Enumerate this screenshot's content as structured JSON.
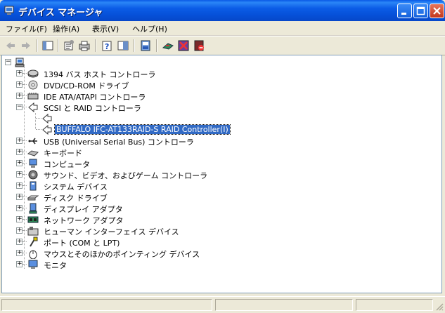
{
  "window": {
    "title": "デバイス マネージャ",
    "icon": "computer-monitor-icon"
  },
  "menu": [
    "ファイル(F)",
    "操作(A)",
    "表示(V)",
    "ヘルプ(H)"
  ],
  "toolbar": {
    "icons": [
      "back-arrow-icon",
      "forward-arrow-icon",
      "show-hide-tree-icon",
      "properties-icon",
      "print-icon",
      "help-icon",
      "view-icon",
      "scan-hardware-icon",
      "update-driver-icon",
      "uninstall-icon",
      "disable-icon"
    ]
  },
  "tree": {
    "root_icon": "computer-icon",
    "items": [
      {
        "label": "1394 バス ホスト コントローラ",
        "icon": "1394-controller-icon",
        "expanded": false
      },
      {
        "label": "DVD/CD-ROM ドライブ",
        "icon": "cdrom-drive-icon",
        "expanded": false
      },
      {
        "label": "IDE ATA/ATAPI コントローラ",
        "icon": "ide-controller-icon",
        "expanded": false
      },
      {
        "label": "SCSI と RAID コントローラ",
        "icon": "scsi-controller-icon",
        "expanded": true,
        "children": [
          {
            "label": "",
            "icon": "scsi-device-icon"
          },
          {
            "label": "BUFFALO IFC-AT133RAID-S RAID Controller(I)",
            "icon": "scsi-device-icon",
            "selected": true
          }
        ]
      },
      {
        "label": "USB (Universal Serial Bus) コントローラ",
        "icon": "usb-icon",
        "expanded": false
      },
      {
        "label": "キーボード",
        "icon": "keyboard-icon",
        "expanded": false
      },
      {
        "label": "コンピュータ",
        "icon": "computer-icon",
        "expanded": false
      },
      {
        "label": "サウンド、ビデオ、およびゲーム コントローラ",
        "icon": "sound-icon",
        "expanded": false
      },
      {
        "label": "システム デバイス",
        "icon": "system-device-icon",
        "expanded": false
      },
      {
        "label": "ディスク ドライブ",
        "icon": "disk-drive-icon",
        "expanded": false
      },
      {
        "label": "ディスプレイ アダプタ",
        "icon": "display-adapter-icon",
        "expanded": false
      },
      {
        "label": "ネットワーク アダプタ",
        "icon": "network-adapter-icon",
        "expanded": false
      },
      {
        "label": "ヒューマン インターフェイス デバイス",
        "icon": "hid-icon",
        "expanded": false
      },
      {
        "label": "ポート (COM と LPT)",
        "icon": "port-icon",
        "expanded": false
      },
      {
        "label": "マウスとそのほかのポインティング デバイス",
        "icon": "mouse-icon",
        "expanded": false
      },
      {
        "label": "モニタ",
        "icon": "monitor-icon",
        "expanded": false
      }
    ]
  },
  "colors": {
    "titlebar": "#0651d9",
    "selection": "#316ac5",
    "chrome": "#ece9d8"
  }
}
